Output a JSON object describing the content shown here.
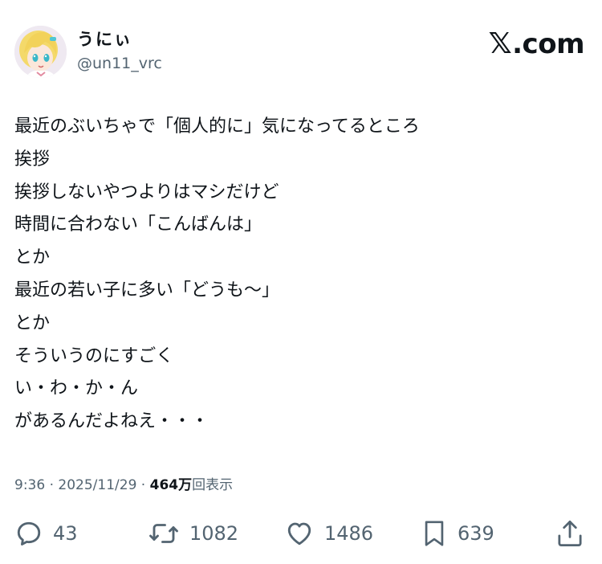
{
  "user": {
    "display_name": "うにぃ",
    "handle": "@un11_vrc",
    "avatar_icon": "anime-avatar-icon"
  },
  "brand": {
    "x_mark": "𝕏",
    "domain": ".com"
  },
  "tweet": {
    "lines": [
      "最近のぶいちゃで「個人的に」気になってるところ",
      "挨拶",
      "挨拶しないやつよりはマシだけど",
      "時間に合わない「こんばんは」",
      "とか",
      "最近の若い子に多い「どうも〜」",
      "とか",
      "そういうのにすごく",
      "い・わ・か・ん",
      "があるんだよねえ・・・"
    ]
  },
  "meta": {
    "time": "9:36",
    "separator": " · ",
    "date": "2025/11/29",
    "views_count": "464万",
    "views_label": "回表示"
  },
  "actions": {
    "replies": "43",
    "retweets": "1082",
    "likes": "1486",
    "bookmarks": "639"
  },
  "colors": {
    "text_primary": "#0f1419",
    "text_secondary": "#536471",
    "background": "#ffffff"
  }
}
